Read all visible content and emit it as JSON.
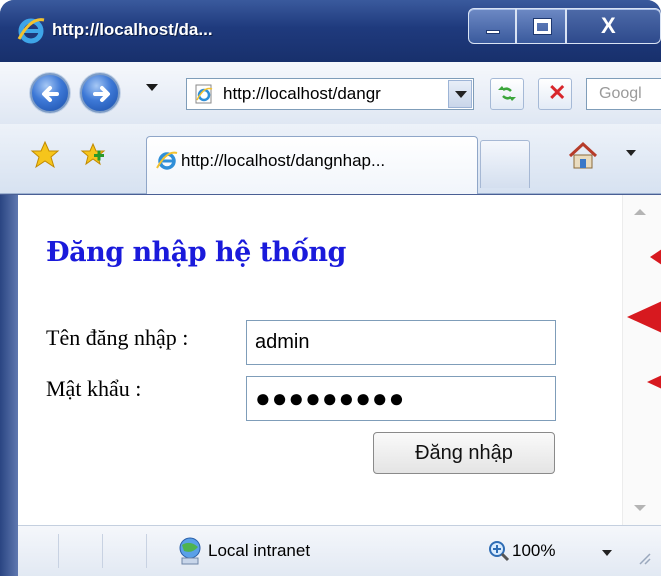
{
  "window": {
    "title": "http://localhost/da..."
  },
  "navbar": {
    "address": "http://localhost/dangr",
    "search_placeholder": "Googl"
  },
  "tabs": [
    {
      "label": "http://localhost/dangnhap..."
    }
  ],
  "page": {
    "heading": "Đăng nhập hệ thống",
    "username_label": "Tên đăng nhập :",
    "username_value": "admin",
    "password_label": "Mật khẩu :",
    "password_value": "●●●●●●●●●",
    "submit_label": "Đăng nhập"
  },
  "statusbar": {
    "zone": "Local intranet",
    "zoom": "100%"
  },
  "colors": {
    "heading": "#1a1adb",
    "annotation_arrows": "#d7191f",
    "titlebar": "#1f3a7d"
  }
}
